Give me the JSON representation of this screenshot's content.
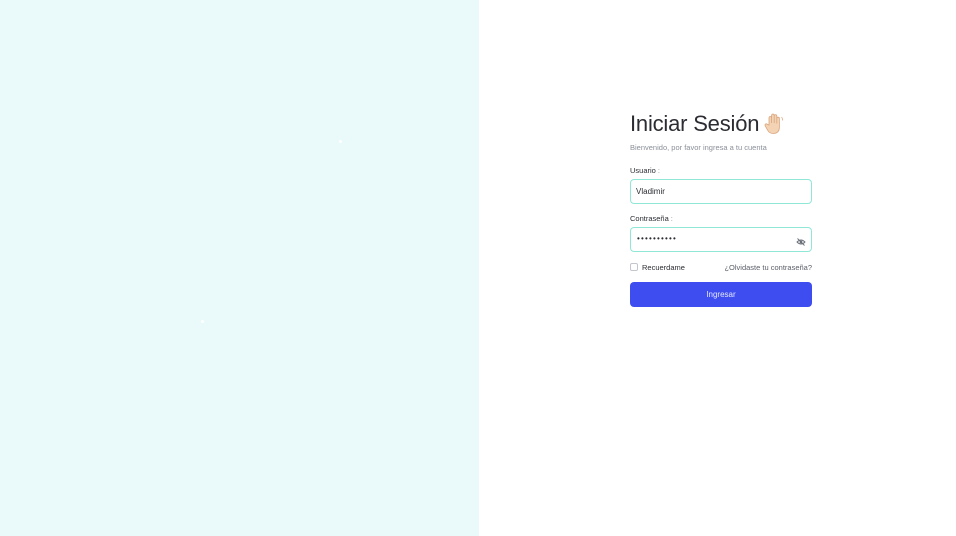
{
  "login": {
    "title": "Iniciar Sesión",
    "wave_icon": "waving-hand-icon",
    "subtitle": "Bienvenido, por favor ingresa a tu cuenta",
    "username": {
      "label": "Usuario",
      "required_mark": ":",
      "value": "Vladimir"
    },
    "password": {
      "label": "Contraseña",
      "required_mark": ":",
      "masked_value": "••••••••••",
      "toggle_icon": "eye-off-icon"
    },
    "remember_label": "Recuerdame",
    "remember_checked": false,
    "forgot_label": "¿Olvidaste tu contraseña?",
    "submit_label": "Ingresar"
  },
  "colors": {
    "left_panel_bg": "#eaf9fa",
    "input_border": "#8fe8d6",
    "primary_button": "#3d4df0"
  }
}
